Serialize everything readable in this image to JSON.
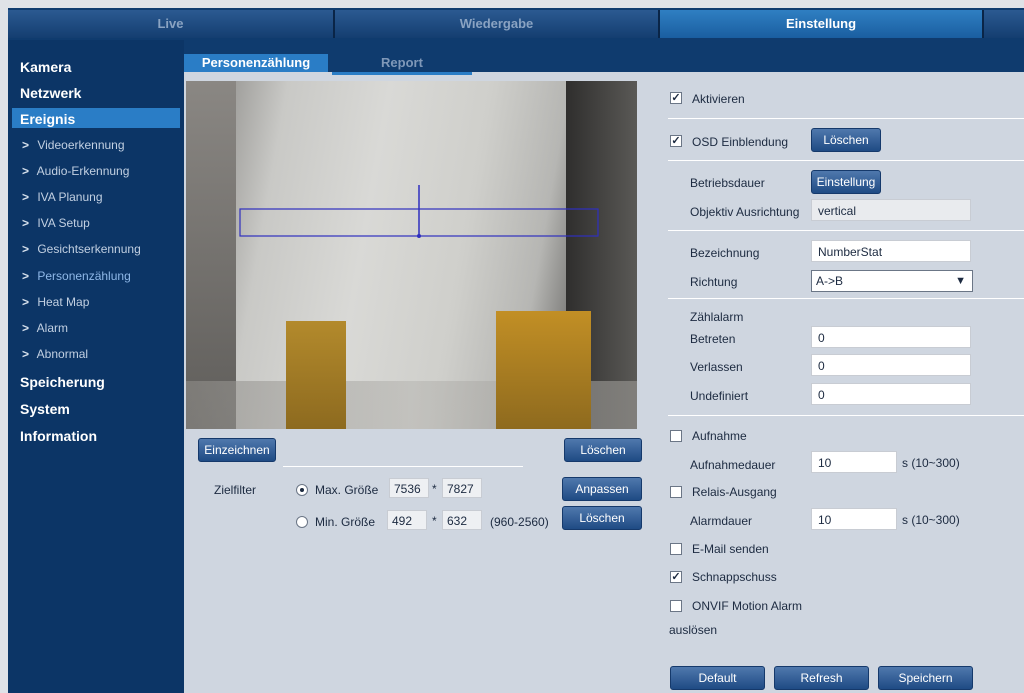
{
  "nav": {
    "tabs": [
      "Live",
      "Wiedergabe",
      "Einstellung"
    ],
    "active": "Einstellung"
  },
  "sidebar": {
    "sections": [
      "Kamera",
      "Netzwerk",
      "Ereignis",
      "Speicherung",
      "System",
      "Information"
    ],
    "active_section": "Ereignis",
    "subitems": [
      "Videoerkennung",
      "Audio-Erkennung",
      "IVA Planung",
      "IVA Setup",
      "Gesichtserkennung",
      "Personenzählung",
      "Heat Map",
      "Alarm",
      "Abnormal"
    ],
    "active_subitem": "Personenzählung"
  },
  "subtabs": [
    "Personenzählung",
    "Report"
  ],
  "video_controls": {
    "draw_button": "Einzeichnen",
    "clear_button": "Löschen",
    "target_filter_label": "Zielfilter",
    "max_size_label": "Max. Größe",
    "max_w": "7536",
    "max_h": "7827",
    "min_size_label": "Min. Größe",
    "min_w": "492",
    "min_h": "632",
    "range_hint": "(960-2560)",
    "separator": "*",
    "adjust_button": "Anpassen",
    "clear2_button": "Löschen"
  },
  "settings": {
    "enable_label": "Aktivieren",
    "enable_checked": true,
    "osd_label": "OSD Einblendung",
    "osd_checked": true,
    "osd_clear_button": "Löschen",
    "runtime_label": "Betriebsdauer",
    "runtime_button": "Einstellung",
    "lens_label": "Objektiv Ausrichtung",
    "lens_value": "vertical",
    "name_label": "Bezeichnung",
    "name_value": "NumberStat",
    "direction_label": "Richtung",
    "direction_value": "A->B",
    "count_alarm_label": "Zählalarm",
    "enter_label": "Betreten",
    "enter_value": "0",
    "leave_label": "Verlassen",
    "leave_value": "0",
    "undefined_label": "Undefiniert",
    "undefined_value": "0",
    "record_label": "Aufnahme",
    "record_checked": false,
    "record_duration_label": "Aufnahmedauer",
    "record_duration_value": "10",
    "record_range": "s (10~300)",
    "relay_label": "Relais-Ausgang",
    "relay_checked": false,
    "alarm_duration_label": "Alarmdauer",
    "alarm_duration_value": "10",
    "alarm_range": "s (10~300)",
    "email_label": "E-Mail senden",
    "email_checked": false,
    "snapshot_label": "Schnappschuss",
    "snapshot_checked": true,
    "onvif_label_1": "ONVIF Motion Alarm",
    "onvif_label_2": "auslösen",
    "onvif_checked": false
  },
  "footer": {
    "default_button": "Default",
    "refresh_button": "Refresh",
    "save_button": "Speichern"
  },
  "colors": {
    "nav_bg": "#0f3b6e",
    "active_blue": "#2a7dc6",
    "content_bg": "#cfd6e0"
  }
}
